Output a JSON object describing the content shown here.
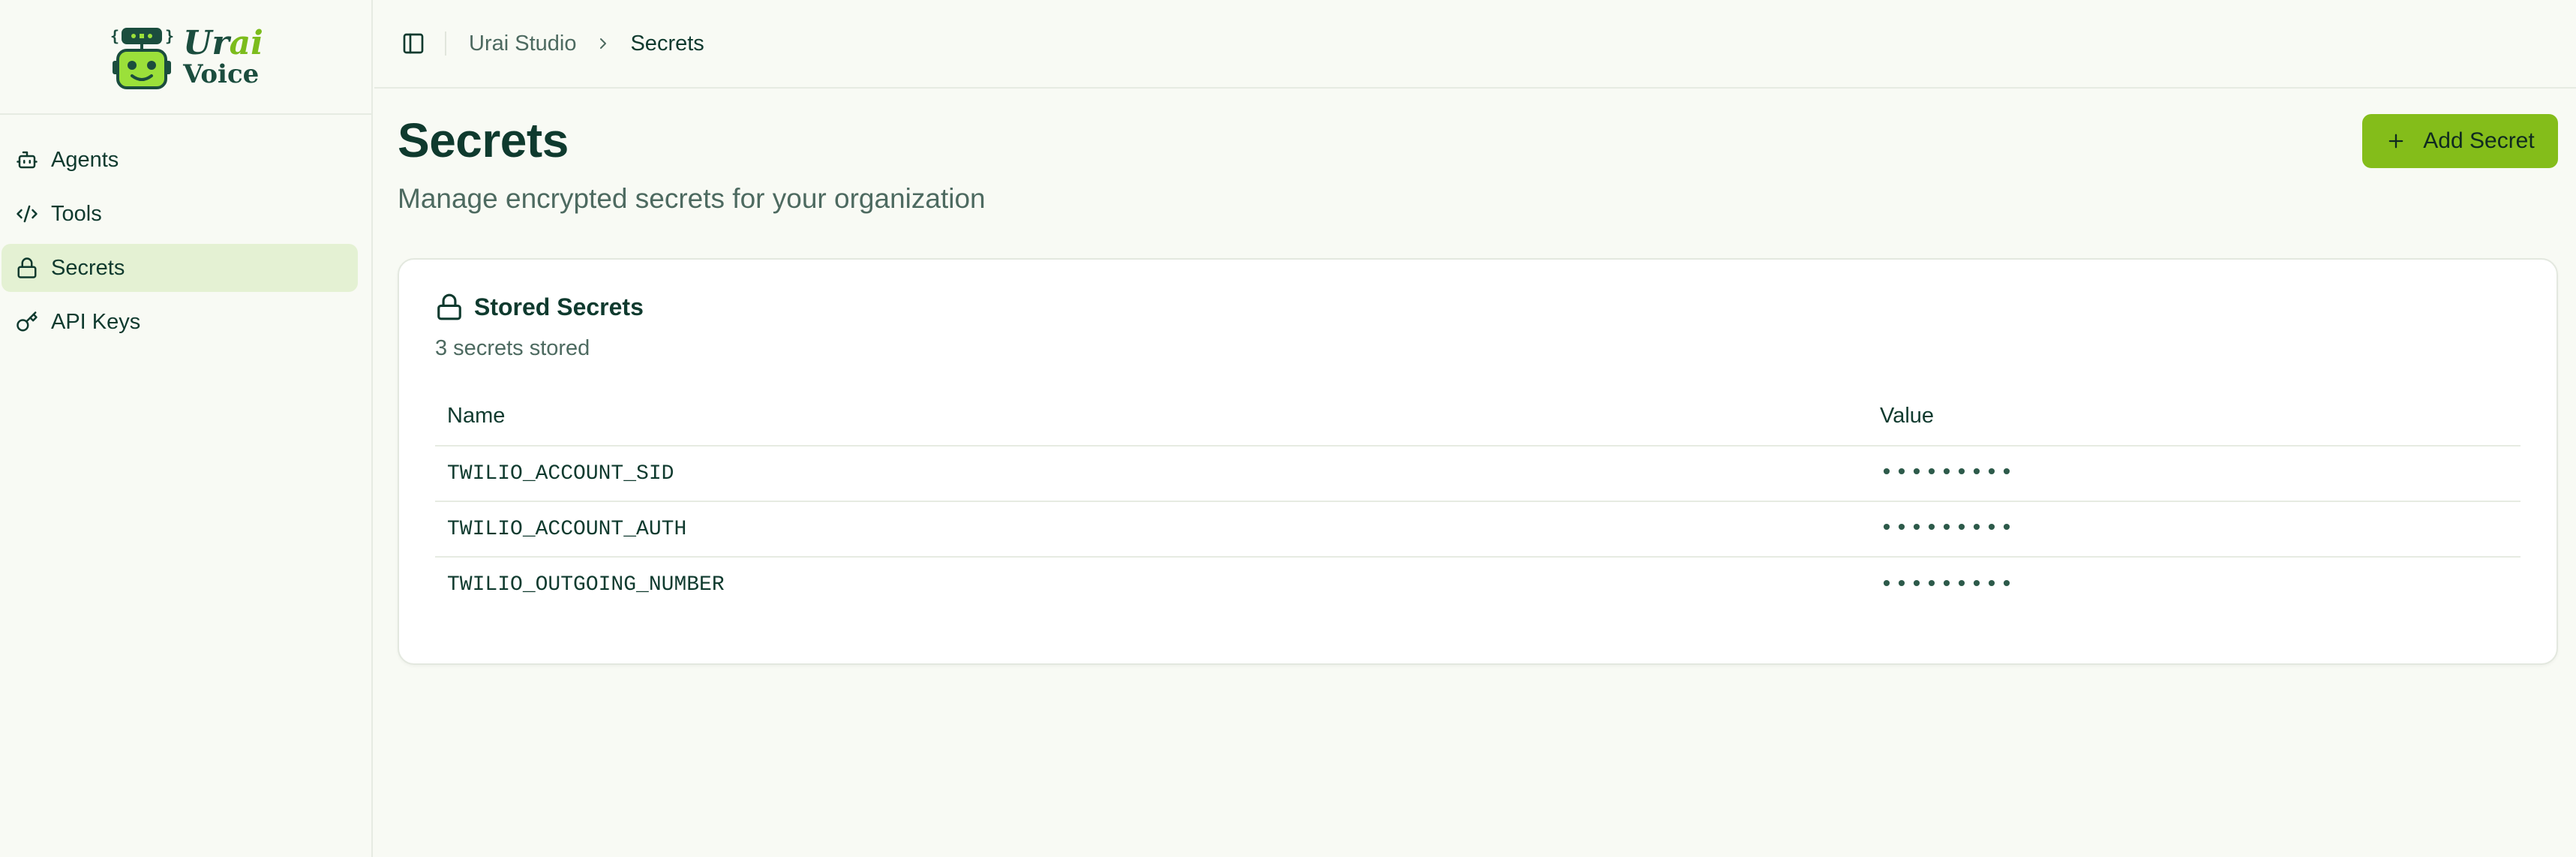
{
  "app": {
    "logo_word1": "Ur",
    "logo_word1_accent": "ai",
    "logo_word2": "Voice",
    "logo_badge": "{0_0|0}"
  },
  "sidebar": {
    "items": [
      {
        "label": "Agents",
        "icon": "bot-icon",
        "active": false
      },
      {
        "label": "Tools",
        "icon": "code-icon",
        "active": false
      },
      {
        "label": "Secrets",
        "icon": "lock-icon",
        "active": true
      },
      {
        "label": "API Keys",
        "icon": "key-icon",
        "active": false
      }
    ]
  },
  "topbar": {
    "breadcrumb": [
      "Urai Studio",
      "Secrets"
    ]
  },
  "page": {
    "title": "Secrets",
    "subtitle": "Manage encrypted secrets for your organization",
    "add_button_label": "Add Secret"
  },
  "card": {
    "title": "Stored Secrets",
    "subtitle": "3 secrets stored",
    "columns": [
      "Name",
      "Value"
    ],
    "rows": [
      {
        "name": "TWILIO_ACCOUNT_SID",
        "value": "•••••••••"
      },
      {
        "name": "TWILIO_ACCOUNT_AUTH",
        "value": "•••••••••"
      },
      {
        "name": "TWILIO_OUTGOING_NUMBER",
        "value": "•••••••••"
      }
    ]
  },
  "colors": {
    "accent": "#84bd1a",
    "active_nav_bg": "#e4f1d3",
    "text_primary": "#0f3a2e",
    "text_muted": "#4d6a60",
    "background": "#f8faf4"
  }
}
